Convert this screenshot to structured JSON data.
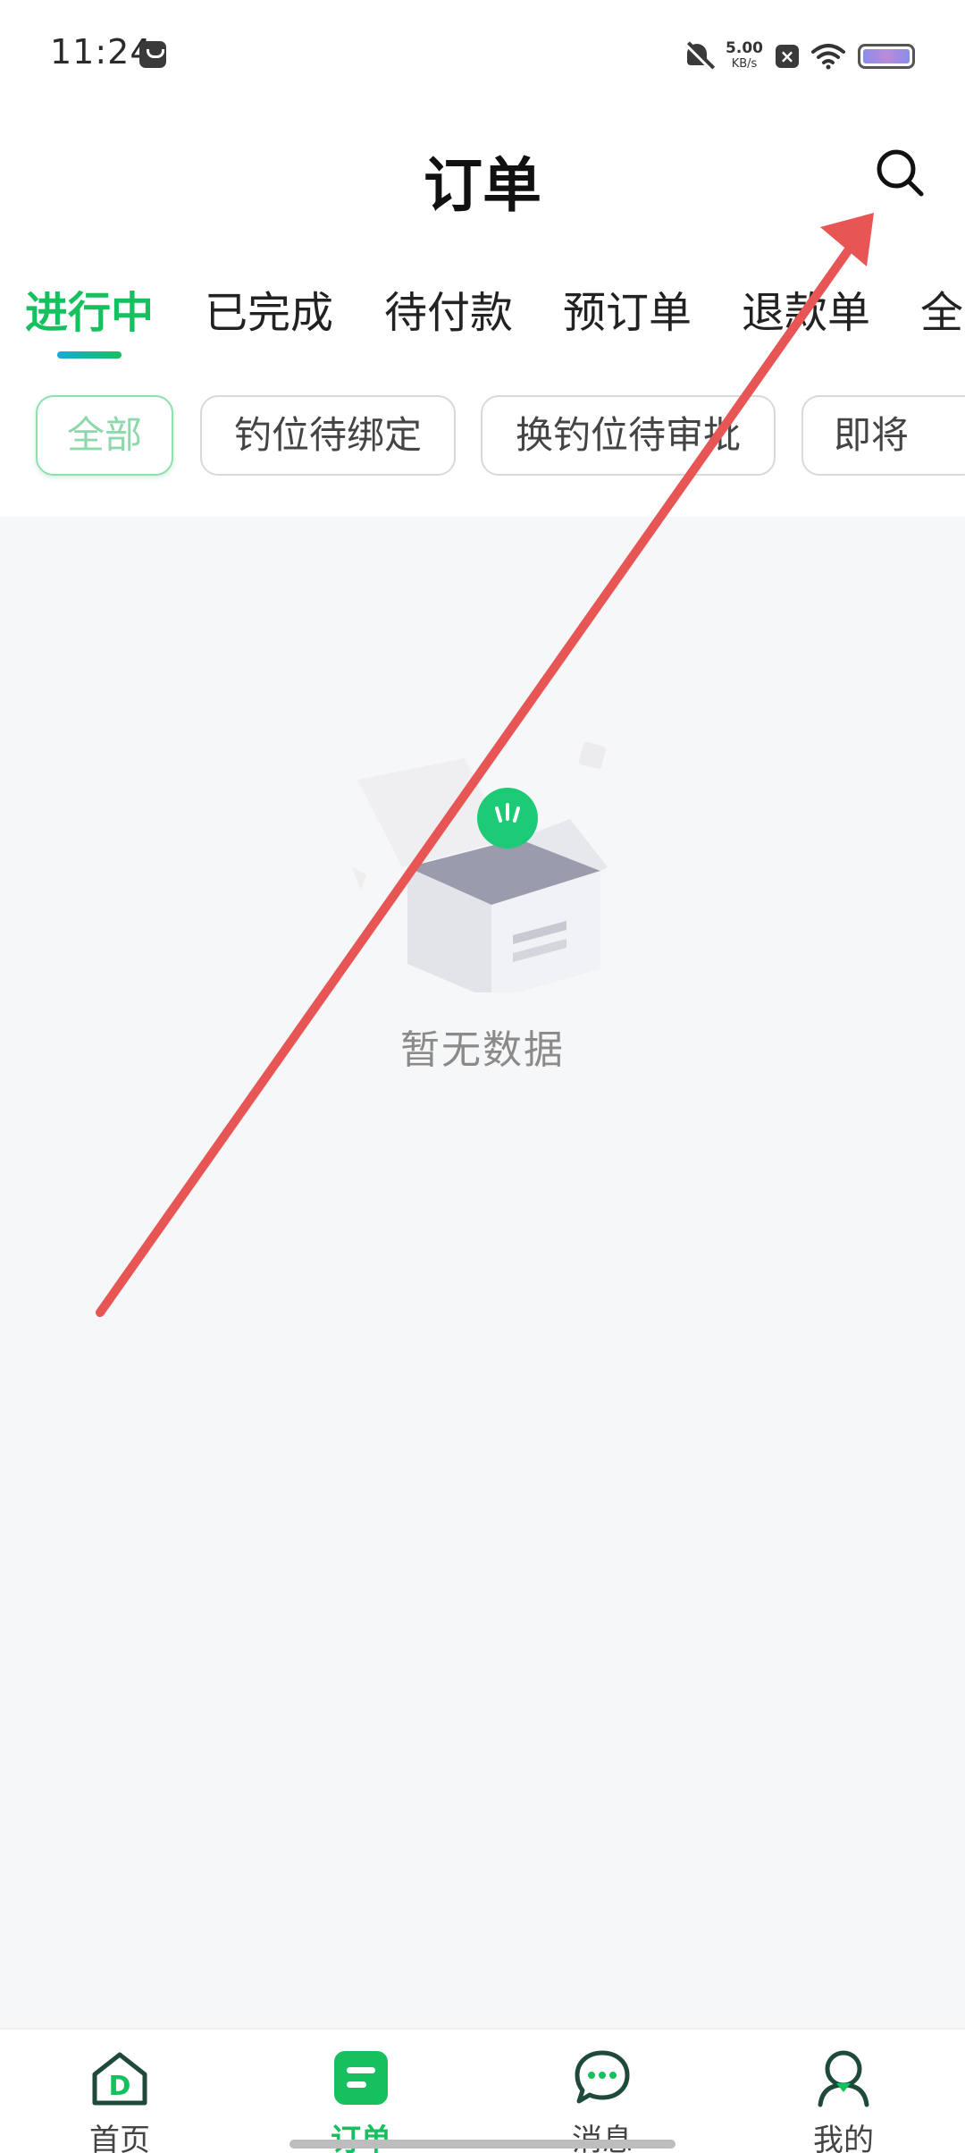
{
  "status_bar": {
    "time": "11:24",
    "net_speed_value": "5.00",
    "net_speed_unit": "KB/s",
    "icons": [
      "bag-icon",
      "mute-icon",
      "close-notify-icon",
      "wifi-icon",
      "battery-icon"
    ]
  },
  "header": {
    "title": "订单",
    "search_icon": "search-icon"
  },
  "tabs": [
    {
      "label": "进行中",
      "active": true
    },
    {
      "label": "已完成",
      "active": false
    },
    {
      "label": "待付款",
      "active": false
    },
    {
      "label": "预订单",
      "active": false
    },
    {
      "label": "退款单",
      "active": false
    },
    {
      "label": "全",
      "active": false
    }
  ],
  "filters": [
    {
      "label": "全部",
      "active": true
    },
    {
      "label": "钓位待绑定",
      "active": false
    },
    {
      "label": "换钓位待审批",
      "active": false
    },
    {
      "label": "即将",
      "active": false
    }
  ],
  "empty_state": {
    "message": "暂无数据",
    "illustration": "empty-box-illustration"
  },
  "bottom_nav": [
    {
      "label": "首页",
      "icon": "home-icon",
      "active": false
    },
    {
      "label": "订单",
      "icon": "order-icon",
      "active": true
    },
    {
      "label": "消息",
      "icon": "message-icon",
      "active": false
    },
    {
      "label": "我的",
      "icon": "profile-icon",
      "active": false
    }
  ],
  "colors": {
    "accent": "#17c05e",
    "background": "#f6f7f8",
    "annotation_arrow": "#e85555"
  }
}
